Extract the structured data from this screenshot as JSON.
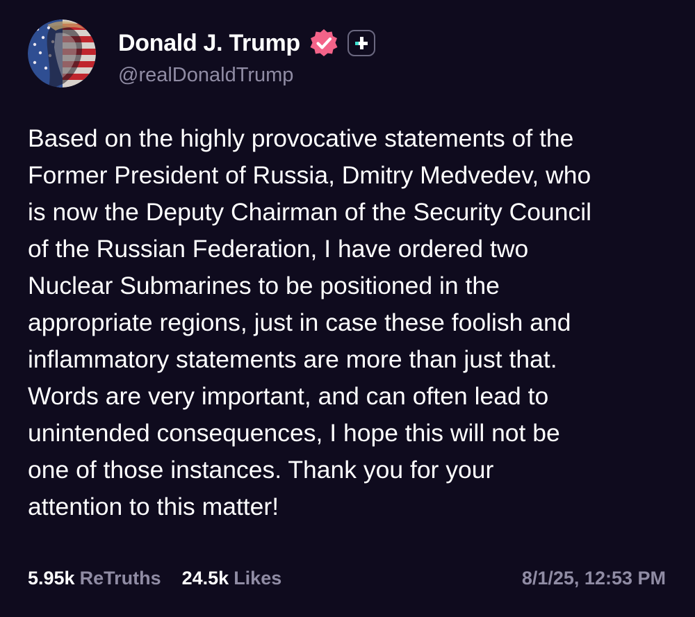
{
  "author": {
    "display_name": "Donald J. Trump",
    "handle": "@realDonaldTrump",
    "verified_icon": "verified-badge-icon",
    "plus_icon": "plus-badge-icon"
  },
  "post": {
    "lines": [
      "Based on the highly provocative statements of the",
      "Former President of Russia, Dmitry Medvedev, who",
      "is now the Deputy Chairman of the Security Council",
      "of the Russian Federation, I have ordered two",
      "Nuclear Submarines to be positioned in the",
      "appropriate regions, just in case these foolish and",
      "inflammatory statements are more than just that.",
      "Words are very important, and can often lead to",
      "unintended consequences, I hope this will not be",
      "one of those instances. Thank you for your",
      "attention to this matter!"
    ]
  },
  "stats": {
    "retruths_count": "5.95k",
    "retruths_label": "ReTruths",
    "likes_count": "24.5k",
    "likes_label": "Likes"
  },
  "timestamp": "8/1/25, 12:53 PM",
  "colors": {
    "background": "#0f0b1e",
    "text_primary": "#ffffff",
    "text_secondary": "#908ca4",
    "verified_badge": "#f36389",
    "plus_accent": "#3fe0d0"
  }
}
